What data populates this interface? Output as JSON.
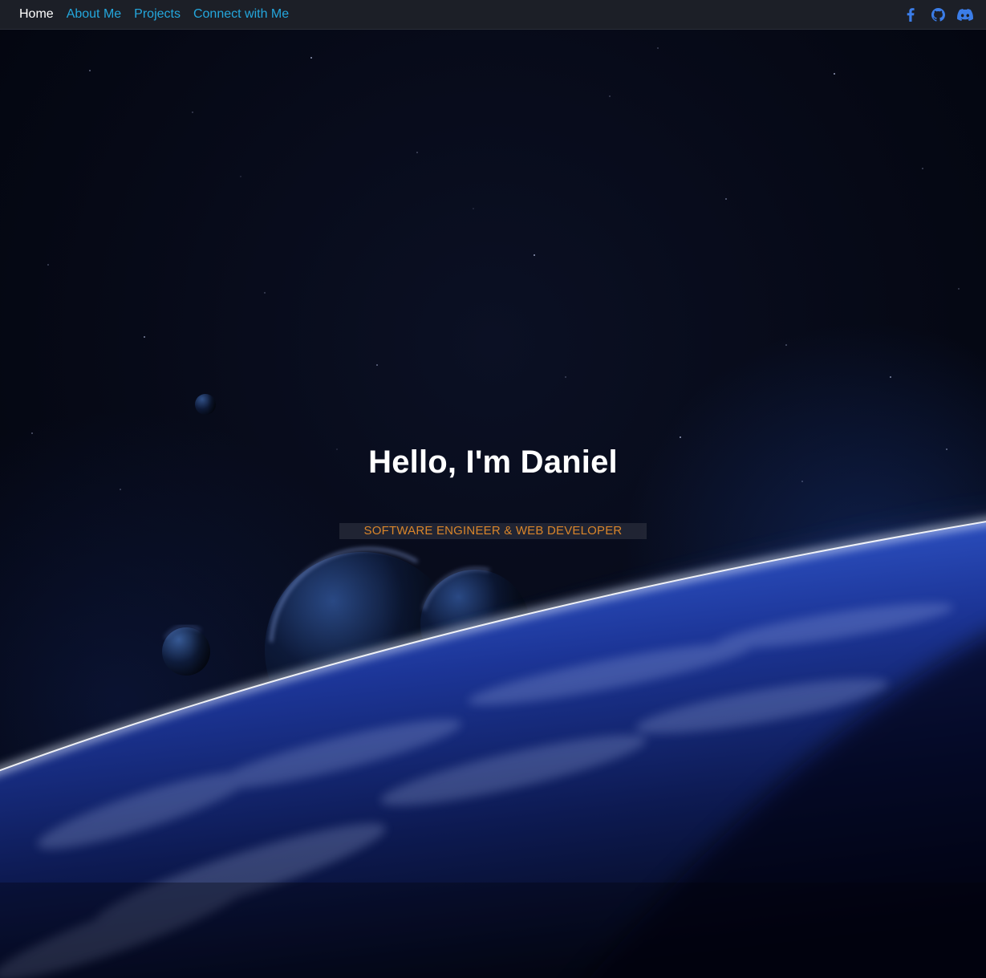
{
  "nav": {
    "links": [
      {
        "label": "Home",
        "active": true
      },
      {
        "label": "About Me",
        "active": false
      },
      {
        "label": "Projects",
        "active": false
      },
      {
        "label": "Connect with Me",
        "active": false
      }
    ],
    "icons": [
      "facebook-icon",
      "github-icon",
      "discord-icon"
    ]
  },
  "hero": {
    "title": "Hello, I'm Daniel",
    "subtitle": "SOFTWARE ENGINEER & WEB DEVELOPER"
  },
  "colors": {
    "nav_background": "#1c1f27",
    "nav_link": "#24a7dd",
    "nav_link_active": "#ffffff",
    "icon": "#3b7de8",
    "subtitle": "#d9852a",
    "space": "#05070f",
    "planet_glow": "#3b6cf0"
  }
}
